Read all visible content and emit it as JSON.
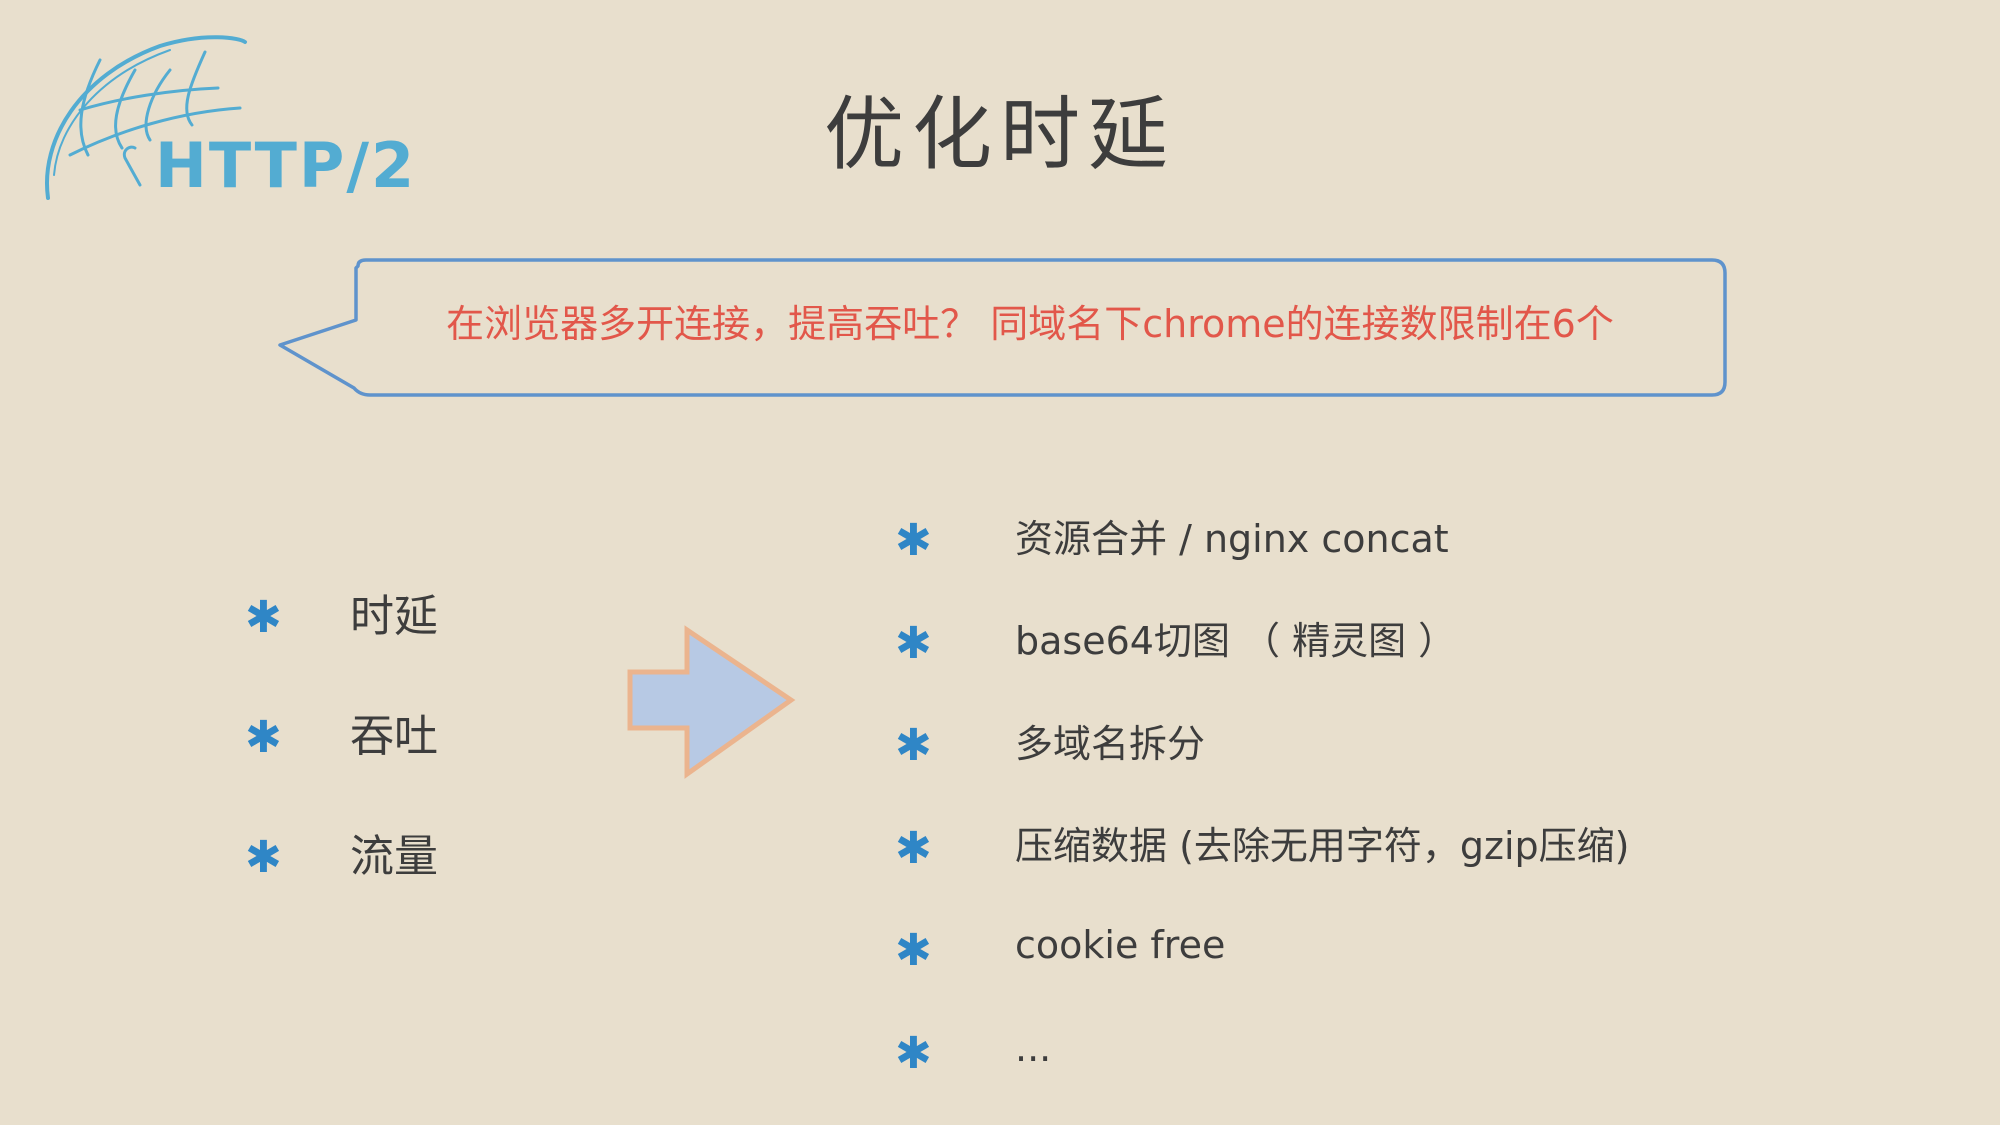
{
  "logo": {
    "text": "HTTP/2"
  },
  "title": "优化时延",
  "callout": {
    "text": "在浏览器多开连接，提高吞吐？ 同域名下chrome的连接数限制在6个"
  },
  "left_items": [
    {
      "label": "时延"
    },
    {
      "label": "吞吐"
    },
    {
      "label": "流量"
    }
  ],
  "right_items": [
    {
      "label": "资源合并 / nginx concat"
    },
    {
      "label": "base64切图 （ 精灵图 ）"
    },
    {
      "label": "多域名拆分"
    },
    {
      "label": "压缩数据 (去除无用字符，gzip压缩)"
    },
    {
      "label": "cookie free"
    },
    {
      "label": "..."
    }
  ],
  "bullet_symbol": "✱",
  "colors": {
    "background": "#e8dfcd",
    "logo_blue": "#53acd2",
    "bullet_blue": "#2f86c6",
    "callout_border": "#5f93cc",
    "callout_text": "#e2574a",
    "arrow_fill": "#b7c9e4",
    "arrow_stroke": "#ebb48e",
    "text": "#3d3d3d"
  },
  "icons": {
    "logo": "globe-swoosh-icon",
    "arrow": "right-arrow-icon",
    "bullet": "asterisk-bullet-icon"
  }
}
